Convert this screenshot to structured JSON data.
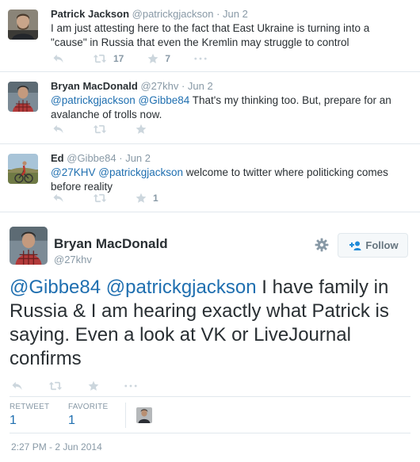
{
  "replies": [
    {
      "name": "Patrick Jackson",
      "handle": "@patrickgjackson",
      "time": "Jun 2",
      "text": "I am just attesting here to the fact that East Ukraine is turning into a \"cause\" in Russia that even the Kremlin may struggle to control",
      "retweets": "17",
      "favorites": "7"
    },
    {
      "name": "Bryan MacDonald",
      "handle": "@27khv",
      "time": "Jun 2",
      "mentions": [
        "@patrickgjackson",
        "@Gibbe84"
      ],
      "text": " That's my thinking too. But, prepare for an avalanche of trolls now.",
      "retweets": "",
      "favorites": ""
    },
    {
      "name": "Ed",
      "handle": "@Gibbe84",
      "time": "Jun 2",
      "mentions": [
        "@27KHV",
        "@patrickgjackson"
      ],
      "text": " welcome to twitter where politicking comes before reality",
      "retweets": "",
      "favorites": "1"
    }
  ],
  "separator": "·",
  "main_tweet": {
    "name": "Bryan MacDonald",
    "handle": "@27khv",
    "follow_label": "Follow",
    "mentions": [
      "@Gibbe84",
      "@patrickgjackson"
    ],
    "text": " I have family in Russia & I am hearing exactly what Patrick is saying. Even a look at VK or LiveJournal confirms",
    "retweet_label": "RETWEET",
    "retweet_count": "1",
    "favorite_label": "FAVORITE",
    "favorite_count": "1",
    "timestamp": "2:27 PM - 2 Jun 2014"
  },
  "icons": {
    "reply": "reply-icon",
    "retweet": "retweet-icon",
    "favorite": "star-icon",
    "more": "more-icon",
    "gear": "gear-icon",
    "follow": "add-user-icon"
  },
  "colors": {
    "link": "#1f6fb0",
    "muted": "#8899a6",
    "icon": "#ccd6dd",
    "text": "#292f33"
  }
}
